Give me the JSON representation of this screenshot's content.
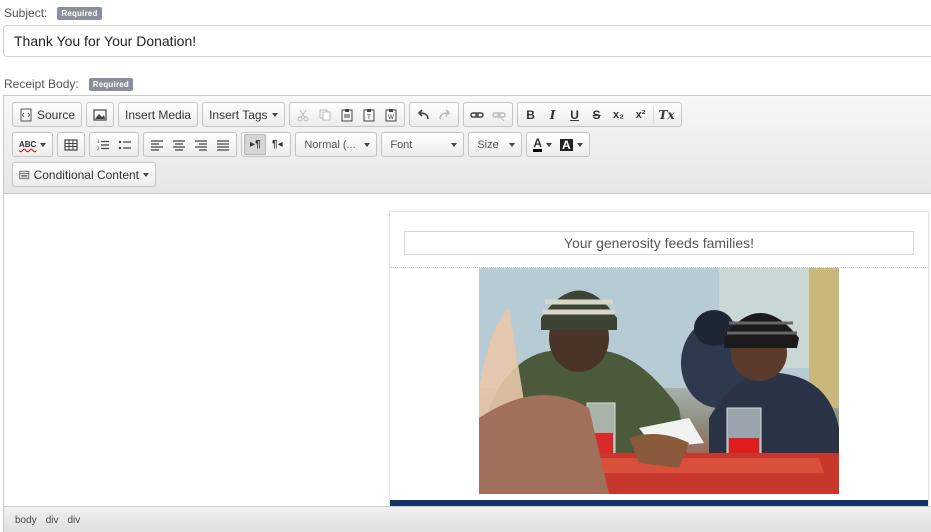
{
  "subject": {
    "label": "Subject:",
    "badge": "Required",
    "value": "Thank You for Your Donation!"
  },
  "receipt": {
    "label": "Receipt Body:",
    "badge": "Required"
  },
  "toolbar": {
    "source_label": "Source",
    "insert_media_label": "Insert Media",
    "insert_tags_label": "Insert Tags",
    "format_label": "Normal (...",
    "font_label": "Font",
    "size_label": "Size",
    "conditional_label": "Conditional Content",
    "spell_label": "ABC",
    "text_color_label": "A",
    "bg_color_label": "A",
    "bold": "B",
    "italic": "I",
    "underline": "U",
    "strike": "S",
    "subscript": "x₂",
    "superscript": "x²",
    "remove_format": "Tx",
    "ltr": "▸¶",
    "rtl": "¶◂"
  },
  "content": {
    "header_text": "Your generosity feeds families!",
    "accent_bar_color": "#10346a"
  },
  "statusbar": {
    "path": [
      "body",
      "div",
      "div"
    ]
  }
}
